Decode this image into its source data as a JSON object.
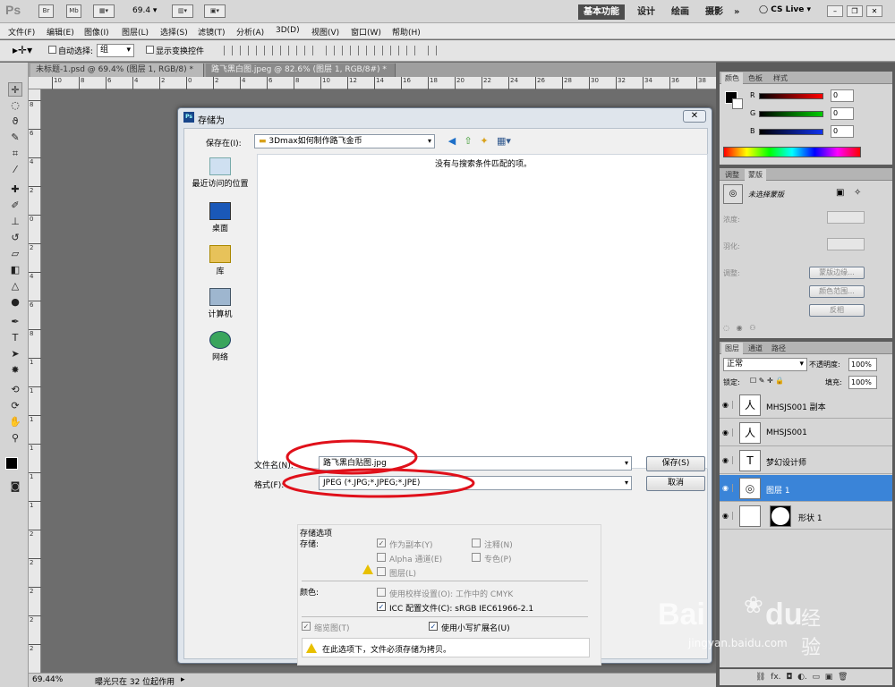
{
  "app": {
    "logo": "Ps",
    "top_icons": [
      "Br",
      "Mb"
    ],
    "zoom_value": "69.4",
    "workspaces": [
      "基本功能",
      "设计",
      "绘画",
      "摄影"
    ],
    "more": "»",
    "cs_live": "CS Live"
  },
  "menu": [
    "文件(F)",
    "编辑(E)",
    "图像(I)",
    "图层(L)",
    "选择(S)",
    "滤镜(T)",
    "分析(A)",
    "3D(D)",
    "视图(V)",
    "窗口(W)",
    "帮助(H)"
  ],
  "options": {
    "auto_select": "自动选择:",
    "auto_select_value": "组",
    "show_transform": "显示变换控件"
  },
  "doc_tabs": [
    "未标题-1.psd @ 69.4% (图层 1, RGB/8) *",
    "路飞黑白图.jpeg @ 82.6% (图层 1, RGB/8#) *"
  ],
  "ruler": {
    "h": [
      "10",
      "8",
      "6",
      "4",
      "2",
      "0",
      "2",
      "4",
      "6",
      "8",
      "10",
      "12",
      "14",
      "16",
      "18",
      "20",
      "22",
      "24",
      "26",
      "28",
      "30",
      "32",
      "34",
      "36",
      "38"
    ],
    "v": [
      "8",
      "6",
      "4",
      "2",
      "0",
      "2",
      "4",
      "6",
      "8",
      "1",
      "1",
      "1",
      "1",
      "1",
      "1",
      "2",
      "2",
      "2",
      "2",
      "2"
    ]
  },
  "status": {
    "zoom": "69.44%",
    "info": "曝光只在 32 位起作用"
  },
  "dialog": {
    "title": "存储为",
    "save_in_label": "保存在(I):",
    "folder": "3Dmax如何制作路飞金币",
    "empty_message": "没有与搜索条件匹配的项。",
    "places": [
      "最近访问的位置",
      "桌面",
      "库",
      "计算机",
      "网络"
    ],
    "filename_label": "文件名(N):",
    "filename": "路飞黑白贴图.jpg",
    "format_label": "格式(F):",
    "format": "JPEG (*.JPG;*.JPEG;*.JPE)",
    "save_btn": "保存(S)",
    "cancel_btn": "取消",
    "options_title": "存储选项",
    "store_label": "存储:",
    "as_copy": "作为副本(Y)",
    "notes": "注释(N)",
    "alpha": "Alpha 通道(E)",
    "spot": "专色(P)",
    "layers": "图层(L)",
    "color_label": "颜色:",
    "use_proof": "使用校样设置(O):  工作中的 CMYK",
    "icc": "ICC 配置文件(C):  sRGB IEC61966-2.1",
    "thumbnail": "缩览图(T)",
    "lowercase": "使用小写扩展名(U)",
    "warning": "在此选项下，文件必须存储为拷贝。"
  },
  "color_panel": {
    "tabs": [
      "颜色",
      "色板",
      "样式"
    ],
    "channels": [
      {
        "name": "R",
        "value": "0",
        "color": "#e01010"
      },
      {
        "name": "G",
        "value": "0",
        "color": "#10c010"
      },
      {
        "name": "B",
        "value": "0",
        "color": "#1030e0"
      }
    ]
  },
  "adjust_panel": {
    "tabs": [
      "调整",
      "蒙版"
    ],
    "no_mask": "未选择蒙版",
    "density": "浓度:",
    "feather": "羽化:",
    "refine": "调整:",
    "mask_edge": "蒙版边缘...",
    "color_range": "颜色范围...",
    "invert": "反相"
  },
  "layers_panel": {
    "tabs": [
      "图层",
      "通道",
      "路径"
    ],
    "blend": "正常",
    "opacity_label": "不透明度:",
    "opacity": "100%",
    "lock_label": "锁定:",
    "fill_label": "填充:",
    "fill": "100%",
    "layers": [
      {
        "name": "MHSJS001 副本",
        "thumb": "人"
      },
      {
        "name": "MHSJS001",
        "thumb": "人"
      },
      {
        "name": "梦幻设计师",
        "thumb": "T"
      },
      {
        "name": "图层 1",
        "thumb": "◎"
      },
      {
        "name": "形状 1",
        "thumb": ""
      }
    ]
  },
  "watermark": {
    "brand": "Bai",
    "brand2": "du",
    "cn": "经验",
    "url": "jingyan.baidu.com"
  },
  "colors": {
    "highlight_circle": "#e0101a",
    "selected_layer": "#3a84d8"
  }
}
